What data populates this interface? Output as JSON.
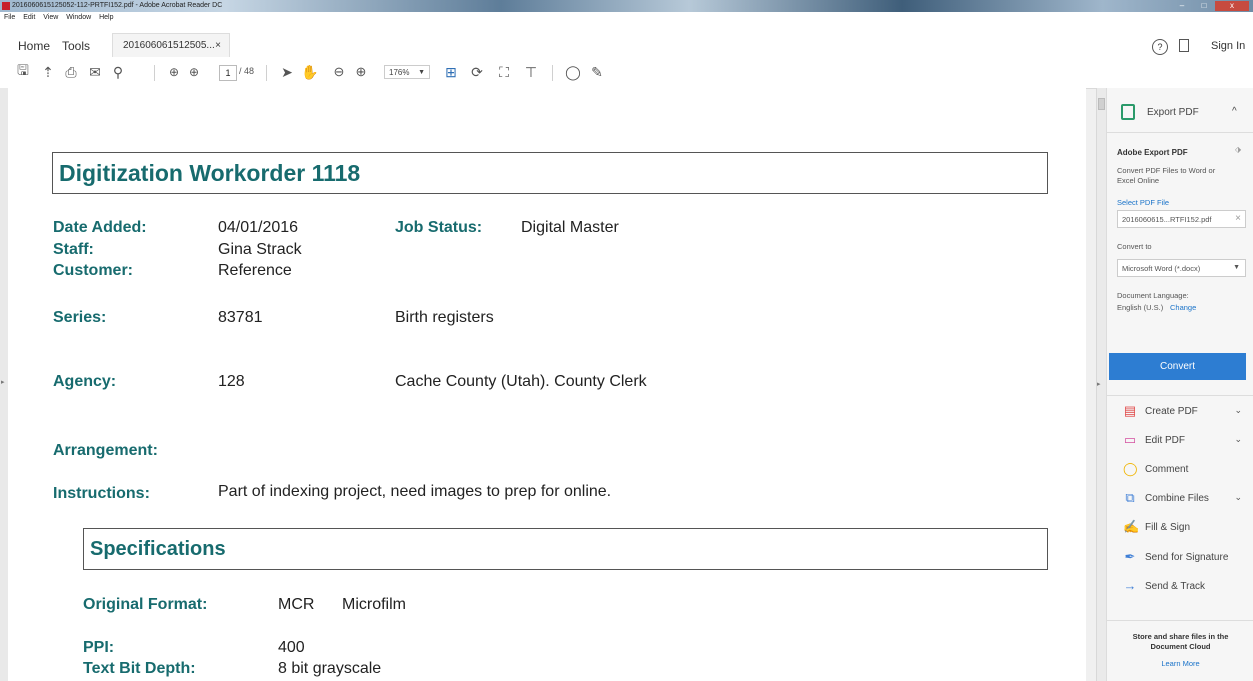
{
  "window": {
    "title": "2016060615125052-112-PRTFI152.pdf - Adobe Acrobat Reader DC",
    "controls": [
      "–",
      "□",
      "x"
    ]
  },
  "menu": [
    "File",
    "Edit",
    "View",
    "Window",
    "Help"
  ],
  "tabs": {
    "home": "Home",
    "tools": "Tools",
    "document": "201606061512505...",
    "close": "×"
  },
  "header_right": {
    "help": "?",
    "sign_in": "Sign In"
  },
  "toolbar": {
    "page_current": "1",
    "page_total": "/ 48",
    "zoom": "176%"
  },
  "document": {
    "title": "Digitization Workorder 1118",
    "date_added_label": "Date Added:",
    "date_added_value": "04/01/2016",
    "job_status_label": "Job Status:",
    "job_status_value": "Digital Master",
    "staff_label": "Staff:",
    "staff_value": "Gina Strack",
    "customer_label": "Customer:",
    "customer_value": "Reference",
    "series_label": "Series:",
    "series_number": "83781",
    "series_name": "Birth registers",
    "agency_label": "Agency:",
    "agency_number": "128",
    "agency_name": "Cache County (Utah). County Clerk",
    "arrangement_label": "Arrangement:",
    "instructions_label": "Instructions:",
    "instructions_value": "Part of indexing project, need images to prep for online.",
    "specs_title": "Specifications",
    "original_format_label": "Original Format:",
    "original_format_code": "MCR",
    "original_format_name": "Microfilm",
    "ppi_label": "PPI:",
    "ppi_value": "400",
    "text_bit_depth_label": "Text Bit Depth:",
    "text_bit_depth_value": "8 bit grayscale"
  },
  "panel": {
    "export_header": "Export PDF",
    "adobe_export_title": "Adobe Export PDF",
    "export_desc_1": "Convert PDF Files to Word or",
    "export_desc_2": "Excel Online",
    "select_pdf": "Select PDF File",
    "selected_file": "2016060615...RTFI152.pdf",
    "convert_to_label": "Convert to",
    "convert_to_value": "Microsoft Word (*.docx)",
    "doc_lang_label": "Document Language:",
    "doc_lang_value": "English (U.S.)",
    "change": "Change",
    "convert_button": "Convert",
    "tools": [
      {
        "label": "Create PDF",
        "chevron": true
      },
      {
        "label": "Edit PDF",
        "chevron": true
      },
      {
        "label": "Comment",
        "chevron": false
      },
      {
        "label": "Combine Files",
        "chevron": true
      },
      {
        "label": "Fill & Sign",
        "chevron": false
      },
      {
        "label": "Send for Signature",
        "chevron": false
      },
      {
        "label": "Send & Track",
        "chevron": false
      }
    ],
    "cloud_text_1": "Store and share files in the",
    "cloud_text_2": "Document Cloud",
    "learn_more": "Learn More"
  },
  "colors": {
    "teal_heading": "#176b6e",
    "convert_blue": "#2d7dd2",
    "link_blue": "#1a73c9"
  }
}
